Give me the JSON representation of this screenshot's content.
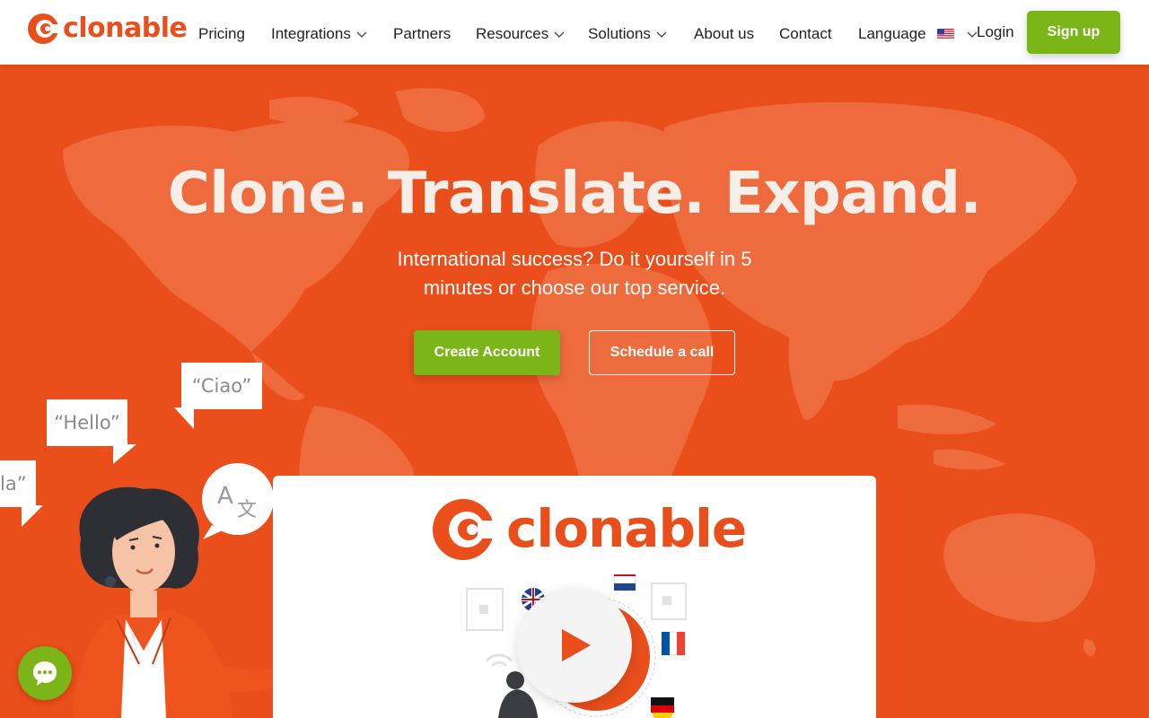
{
  "brand": {
    "name": "clonable",
    "color": "#ea4e1b",
    "accent": "#7cb518"
  },
  "nav": {
    "items": [
      {
        "label": "Pricing",
        "dropdown": false
      },
      {
        "label": "Integrations",
        "dropdown": true
      },
      {
        "label": "Partners",
        "dropdown": false
      },
      {
        "label": "Resources",
        "dropdown": true
      },
      {
        "label": "Solutions",
        "dropdown": true
      },
      {
        "label": "About us",
        "dropdown": false
      },
      {
        "label": "Contact",
        "dropdown": false
      }
    ],
    "language_label": "Language",
    "language_icon": "us-flag-icon",
    "login_label": "Login",
    "signup_label": "Sign up"
  },
  "hero": {
    "title": "Clone. Translate. Expand.",
    "subtitle_line1": "International success? Do it yourself in 5",
    "subtitle_line2": "minutes or choose our top service.",
    "primary_cta": "Create Account",
    "secondary_cta": "Schedule a call"
  },
  "illustration": {
    "bubbles": [
      "“Ciao”",
      "“Hello”",
      "la”"
    ],
    "translate_glyph": "A文"
  },
  "video": {
    "logo_text": "clonable",
    "play_icon": "play-icon"
  },
  "chat": {
    "icon": "chat-icon"
  }
}
